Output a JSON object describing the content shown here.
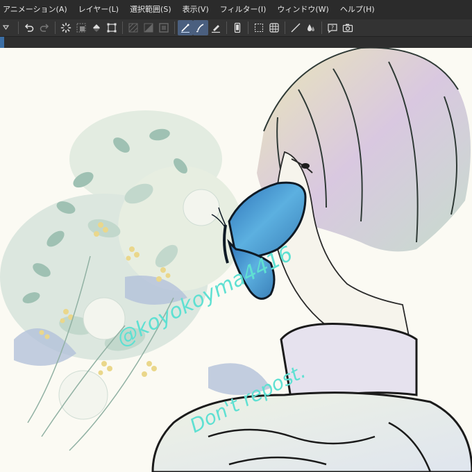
{
  "menubar": {
    "items": [
      "アニメーション(A)",
      "レイヤー(L)",
      "選択範囲(S)",
      "表示(V)",
      "フィルター(I)",
      "ウィンドウ(W)",
      "ヘルプ(H)"
    ]
  },
  "toolbar": {
    "icons": [
      "dropdown-triangle-icon",
      "undo-icon",
      "redo-icon",
      "loading-spinner-icon",
      "clear-selection-icon",
      "fill-bucket-icon",
      "transform-icon",
      "hatch-icon",
      "gradient-icon",
      "frame-icon",
      "pen-icon",
      "brush-icon",
      "marker-icon",
      "phone-icon",
      "selection-rect-icon",
      "grid-icon",
      "line-icon",
      "ink-drops-icon",
      "help-icon",
      "camera-icon"
    ],
    "active_icons": [
      "pen-icon",
      "brush-icon"
    ]
  },
  "canvas": {
    "watermark_lines": [
      "@koyokoyma4416",
      "Don't repost."
    ],
    "colors": {
      "paper": "#fbfaf3",
      "line": "#1b1b1b",
      "watermark": "#5fe0d2",
      "butterfly": "#3b8fd0",
      "flowers_yellow": "#e8d27a",
      "leaves": "#8fb8a8"
    }
  }
}
